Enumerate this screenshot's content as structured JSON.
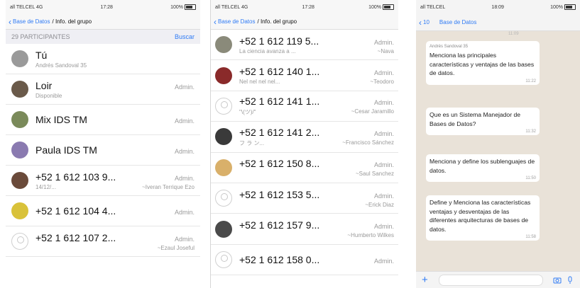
{
  "colors": {
    "accent": "#2f7bf5",
    "chat_bg": "#e9e2d8"
  },
  "screen1": {
    "status": {
      "left": "all TELCEL 4G",
      "time": "17:28",
      "right": "100%"
    },
    "nav": {
      "back_label": "Base de Datos",
      "title": "Info. del grupo"
    },
    "participants_header": "29 PARTICIPANTES",
    "edit_label": "Buscar",
    "rows": [
      {
        "name": "Tú",
        "role": "",
        "sub": "Andrés Sandoval 35",
        "sub2": "",
        "avatar": "#9a9a9a"
      },
      {
        "name": "Loir",
        "role": "Admin.",
        "sub": "Disponible",
        "sub2": "",
        "avatar": "#6a5a4a"
      },
      {
        "name": "Mix IDS TM",
        "role": "Admin.",
        "sub": "",
        "sub2": "",
        "avatar": "#7a8a5a"
      },
      {
        "name": "Paula IDS TM",
        "role": "Admin.",
        "sub": "",
        "sub2": "",
        "avatar": "#8a7ab0"
      },
      {
        "name": "+52 1 612 103 9...",
        "role": "Admin.",
        "sub": "14/12/...",
        "sub2": "~Iveran Terrique Ezo",
        "avatar": "#6a4a3a"
      },
      {
        "name": "+52 1 612 104 4...",
        "role": "Admin.",
        "sub": "",
        "sub2": "",
        "avatar": "#d9c23a"
      },
      {
        "name": "+52 1 612 107 2...",
        "role": "Admin.",
        "sub": "",
        "sub2": "~Ezaul Joseful",
        "avatar": "blank"
      }
    ]
  },
  "screen2": {
    "status": {
      "left": "all TELCEL 4G",
      "time": "17:28",
      "right": "100%"
    },
    "nav": {
      "back_label": "Base de Datos",
      "title": "Info. del grupo"
    },
    "rows": [
      {
        "name": "+52 1 612 119 5...",
        "role": "Admin.",
        "sub": "La ciencia avanza a ...",
        "sub2": "~Nava",
        "avatar": "#8a8a7a"
      },
      {
        "name": "+52 1 612 140 1...",
        "role": "Admin.",
        "sub": "Nel nel nel nel...",
        "sub2": "~Teodoro",
        "avatar": "#8a2a2a"
      },
      {
        "name": "+52 1 612 141 1...",
        "role": "Admin.",
        "sub": "\"\\(ツ)/\"",
        "sub2": "~Cesar Jaramillo",
        "avatar": "blank"
      },
      {
        "name": "+52 1 612 141 2...",
        "role": "Admin.",
        "sub": "フ ラ ン...",
        "sub2": "~Francisco Sánchez",
        "avatar": "#3a3a3a"
      },
      {
        "name": "+52 1 612 150 8...",
        "role": "Admin.",
        "sub": "",
        "sub2": "~Saul Sanchez",
        "avatar": "#d9b06a"
      },
      {
        "name": "+52 1 612 153 5...",
        "role": "Admin.",
        "sub": "",
        "sub2": "~Erick Diaz",
        "avatar": "blank"
      },
      {
        "name": "+52 1 612 157 9...",
        "role": "Admin.",
        "sub": "",
        "sub2": "~Humberto Wilkes",
        "avatar": "#4a4a4a"
      },
      {
        "name": "+52 1 612 158 0...",
        "role": "Admin.",
        "sub": "",
        "sub2": "",
        "avatar": "blank"
      }
    ]
  },
  "screen3": {
    "status": {
      "left": "all TELCEL",
      "time": "18:09",
      "right": "100%"
    },
    "nav": {
      "back_label": "10",
      "title": "Base de Datos"
    },
    "top_time": "11:09",
    "messages": [
      {
        "sender": "Andrés Sandoval 35",
        "text": "Menciona las principales características y ventajas de las bases de datos.",
        "time": "11:22"
      },
      {
        "sender": "",
        "text": "Que es un Sistema Manejador de Bases de Datos?",
        "time": "11:32"
      },
      {
        "sender": "",
        "text": "Menciona y define los sublenguajes de datos.",
        "time": "11:50"
      },
      {
        "sender": "",
        "text": "Define y Menciona las características ventajas y desventajas de las diferentes arquitecturas de bases de datos.",
        "time": "11:58"
      }
    ],
    "input": {
      "placeholder": ""
    }
  }
}
